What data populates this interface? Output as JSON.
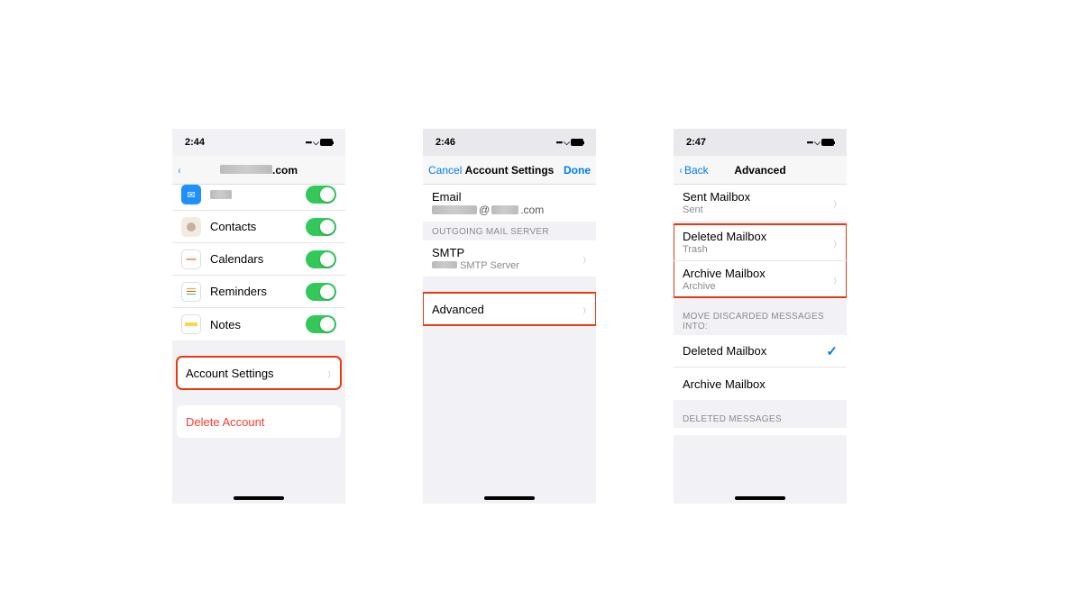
{
  "phone1": {
    "time": "2:44",
    "nav_title_suffix": ".com",
    "rows": {
      "mail": "Mail",
      "contacts": "Contacts",
      "calendars": "Calendars",
      "reminders": "Reminders",
      "notes": "Notes",
      "account_settings": "Account Settings",
      "delete_account": "Delete Account"
    }
  },
  "phone2": {
    "time": "2:46",
    "cancel": "Cancel",
    "title": "Account Settings",
    "done": "Done",
    "email_label": "Email",
    "email_value_suffix": ".com",
    "section_outgoing": "OUTGOING MAIL SERVER",
    "smtp_label": "SMTP",
    "smtp_sub": "SMTP Server",
    "advanced": "Advanced"
  },
  "phone3": {
    "time": "2:47",
    "back": "Back",
    "title": "Advanced",
    "sent_label": "Sent Mailbox",
    "sent_sub": "Sent",
    "deleted_label": "Deleted Mailbox",
    "deleted_sub": "Trash",
    "archive_label": "Archive Mailbox",
    "archive_sub": "Archive",
    "move_header": "MOVE DISCARDED MESSAGES INTO:",
    "opt_deleted": "Deleted Mailbox",
    "opt_archive": "Archive Mailbox",
    "deleted_msgs_header": "DELETED MESSAGES"
  }
}
